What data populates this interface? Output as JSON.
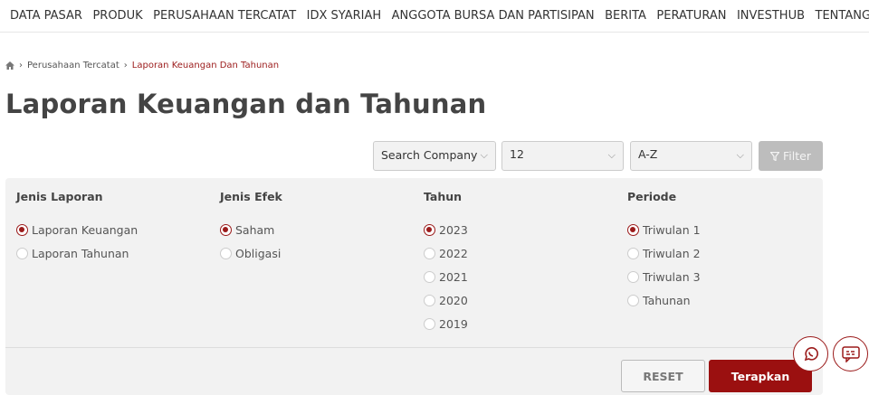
{
  "nav": [
    "DATA PASAR",
    "PRODUK",
    "PERUSAHAAN TERCATAT",
    "IDX SYARIAH",
    "ANGGOTA BURSA DAN PARTISIPAN",
    "BERITA",
    "PERATURAN",
    "INVESTHUB",
    "TENTANG BEI"
  ],
  "breadcrumb": {
    "parent": "Perusahaan Tercatat",
    "current": "Laporan Keuangan Dan Tahunan"
  },
  "title": "Laporan Keuangan dan Tahunan",
  "toolbar": {
    "company": "Search Company",
    "page_size": "12",
    "sort": "A-Z",
    "filter": "Filter"
  },
  "filters": [
    {
      "label": "Jenis Laporan",
      "options": [
        "Laporan Keuangan",
        "Laporan Tahunan"
      ],
      "selected": 0
    },
    {
      "label": "Jenis Efek",
      "options": [
        "Saham",
        "Obligasi"
      ],
      "selected": 0
    },
    {
      "label": "Tahun",
      "options": [
        "2023",
        "2022",
        "2021",
        "2020",
        "2019"
      ],
      "selected": 0
    },
    {
      "label": "Periode",
      "options": [
        "Triwulan 1",
        "Triwulan 2",
        "Triwulan 3",
        "Tahunan"
      ],
      "selected": 0
    }
  ],
  "actions": {
    "reset": "RESET",
    "apply": "Terapkan"
  },
  "colors": {
    "accent": "#9b1010"
  }
}
